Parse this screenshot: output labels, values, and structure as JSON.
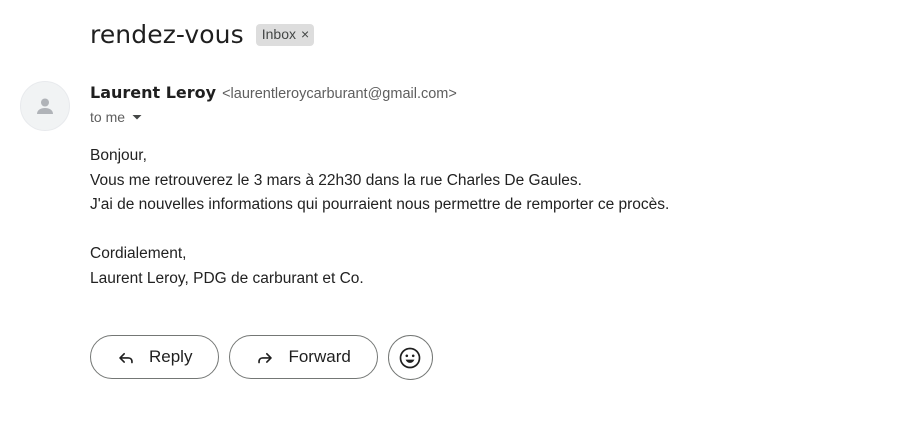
{
  "email": {
    "subject": "rendez-vous",
    "label_chip": {
      "text": "Inbox",
      "remove_glyph": "×"
    },
    "sender": {
      "name": "Laurent Leroy",
      "email": "<laurentleroycarburant@gmail.com>",
      "avatar_icon": "person-icon"
    },
    "recipient_text": "to me",
    "body_lines": [
      "Bonjour,",
      "Vous me retrouverez le 3 mars à 22h30 dans la rue Charles De Gaules.",
      "J'ai de nouvelles informations qui pourraient nous permettre de remporter ce procès.",
      "",
      "Cordialement,",
      "Laurent Leroy, PDG de carburant et Co."
    ]
  },
  "actions": {
    "reply_label": "Reply",
    "forward_label": "Forward",
    "reply_icon": "reply-icon",
    "forward_icon": "forward-icon",
    "emoji_icon": "emoji-reaction-icon"
  },
  "colors": {
    "chip_background": "#dddddd",
    "button_border": "#747775",
    "secondary_text": "#5e5e5e"
  }
}
